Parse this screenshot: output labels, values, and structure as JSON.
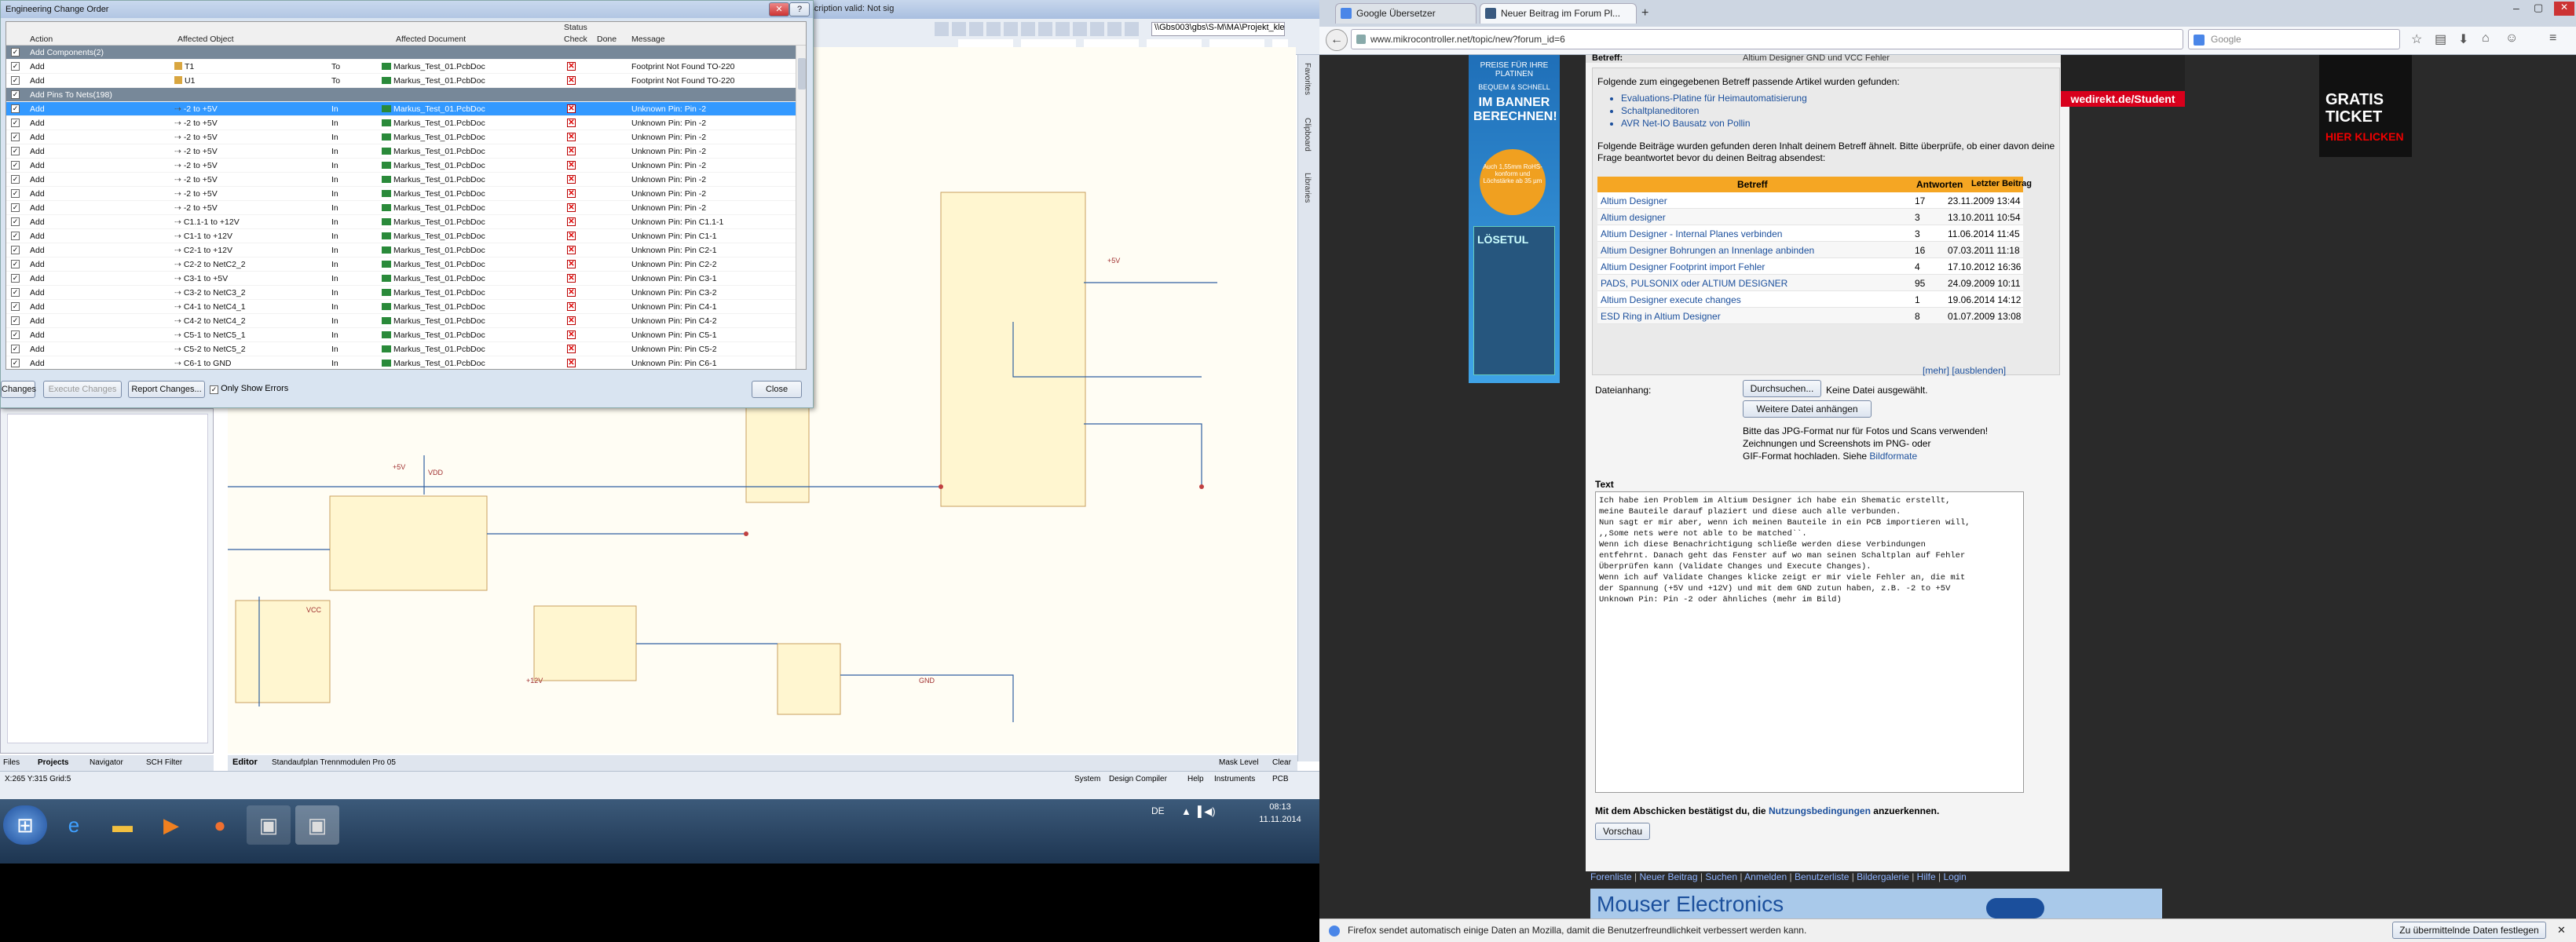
{
  "left_app": {
    "title": "...\\PCB1.PcbDoc - Altium Designer (14.3.12) Licensed to Forschungszentrum Jülich GmbH - Subscription valid: Not sig",
    "path_box": "\\\\Gbs003\\gbs\\S-M\\MA\\Projekt_kle",
    "eco": {
      "title": "Engineering Change Order",
      "col_action": "Action",
      "col_object": "Affected Object",
      "col_document": "Affected Document",
      "col_status": "Status",
      "col_check": "Check",
      "col_done": "Done",
      "col_message": "Message",
      "groups": [
        {
          "label": "Add Components(2)"
        },
        {
          "label": "Add Pins To Nets(198)"
        }
      ],
      "comp_rows": [
        {
          "action": "Add",
          "object": "T1",
          "to": "To",
          "document": "Markus_Test_01.PcbDoc",
          "message": "Footprint Not Found TO-220"
        },
        {
          "action": "Add",
          "object": "U1",
          "to": "To",
          "document": "Markus_Test_01.PcbDoc",
          "message": "Footprint Not Found TO-220"
        }
      ],
      "pin_rows": [
        {
          "action": "Add",
          "object": "-2 to +5V",
          "to": "In",
          "document": "Markus_Test_01.PcbDoc",
          "message": "Unknown Pin: Pin -2"
        },
        {
          "action": "Add",
          "object": "-2 to +5V",
          "to": "In",
          "document": "Markus_Test_01.PcbDoc",
          "message": "Unknown Pin: Pin -2"
        },
        {
          "action": "Add",
          "object": "-2 to +5V",
          "to": "In",
          "document": "Markus_Test_01.PcbDoc",
          "message": "Unknown Pin: Pin -2"
        },
        {
          "action": "Add",
          "object": "-2 to +5V",
          "to": "In",
          "document": "Markus_Test_01.PcbDoc",
          "message": "Unknown Pin: Pin -2"
        },
        {
          "action": "Add",
          "object": "-2 to +5V",
          "to": "In",
          "document": "Markus_Test_01.PcbDoc",
          "message": "Unknown Pin: Pin -2"
        },
        {
          "action": "Add",
          "object": "-2 to +5V",
          "to": "In",
          "document": "Markus_Test_01.PcbDoc",
          "message": "Unknown Pin: Pin -2"
        },
        {
          "action": "Add",
          "object": "-2 to +5V",
          "to": "In",
          "document": "Markus_Test_01.PcbDoc",
          "message": "Unknown Pin: Pin -2"
        },
        {
          "action": "Add",
          "object": "-2 to +5V",
          "to": "In",
          "document": "Markus_Test_01.PcbDoc",
          "message": "Unknown Pin: Pin -2"
        },
        {
          "action": "Add",
          "object": "C1.1-1 to +12V",
          "to": "In",
          "document": "Markus_Test_01.PcbDoc",
          "message": "Unknown Pin: Pin C1.1-1"
        },
        {
          "action": "Add",
          "object": "C1-1 to +12V",
          "to": "In",
          "document": "Markus_Test_01.PcbDoc",
          "message": "Unknown Pin: Pin C1-1"
        },
        {
          "action": "Add",
          "object": "C2-1 to +12V",
          "to": "In",
          "document": "Markus_Test_01.PcbDoc",
          "message": "Unknown Pin: Pin C2-1"
        },
        {
          "action": "Add",
          "object": "C2-2 to NetC2_2",
          "to": "In",
          "document": "Markus_Test_01.PcbDoc",
          "message": "Unknown Pin: Pin C2-2"
        },
        {
          "action": "Add",
          "object": "C3-1 to +5V",
          "to": "In",
          "document": "Markus_Test_01.PcbDoc",
          "message": "Unknown Pin: Pin C3-1"
        },
        {
          "action": "Add",
          "object": "C3-2 to NetC3_2",
          "to": "In",
          "document": "Markus_Test_01.PcbDoc",
          "message": "Unknown Pin: Pin C3-2"
        },
        {
          "action": "Add",
          "object": "C4-1 to NetC4_1",
          "to": "In",
          "document": "Markus_Test_01.PcbDoc",
          "message": "Unknown Pin: Pin C4-1"
        },
        {
          "action": "Add",
          "object": "C4-2 to NetC4_2",
          "to": "In",
          "document": "Markus_Test_01.PcbDoc",
          "message": "Unknown Pin: Pin C4-2"
        },
        {
          "action": "Add",
          "object": "C5-1 to NetC5_1",
          "to": "In",
          "document": "Markus_Test_01.PcbDoc",
          "message": "Unknown Pin: Pin C5-1"
        },
        {
          "action": "Add",
          "object": "C5-2 to NetC5_2",
          "to": "In",
          "document": "Markus_Test_01.PcbDoc",
          "message": "Unknown Pin: Pin C5-2"
        },
        {
          "action": "Add",
          "object": "C6-1 to GND",
          "to": "In",
          "document": "Markus_Test_01.PcbDoc",
          "message": "Unknown Pin: Pin C6-1"
        }
      ],
      "btn_validate": "Changes",
      "btn_execute": "Execute Changes",
      "btn_report": "Report Changes...",
      "chk_only_errors": "Only Show Errors",
      "btn_close": "Close"
    },
    "right_panels": [
      "Favorites",
      "Clipboard",
      "Libraries"
    ],
    "bottom_tabs": [
      "Files",
      "Projects",
      "Navigator",
      "SCH Filter"
    ],
    "doc_tabs": [
      "Editor",
      "Standaufplan Trennmodulen Pro 05"
    ],
    "status_coords": "X:265 Y:315   Grid:5",
    "status_right": [
      "System",
      "Design Compiler",
      "Help",
      "Instruments",
      "PCB"
    ],
    "mask_level": "Mask Level",
    "clear": "Clear",
    "schematic_labels": [
      "VDD",
      "+5V",
      "+12V",
      "GND",
      "VCC"
    ],
    "clock_time": "08:13",
    "clock_date": "11.11.2014",
    "lang": "DE"
  },
  "browser": {
    "tabs": [
      "Google Übersetzer",
      "Neuer Beitrag im Forum Pl..."
    ],
    "url": "www.mikrocontroller.net/topic/new?forum_id=6",
    "search_placeholder": "Google",
    "ad_left": {
      "line1": "PREISE FÜR IHRE PLATINEN",
      "line2": "BEQUEM & SCHNELL",
      "line3": "IM BANNER BERECHNEN!",
      "badge": "Auch 1,55mm RoHS-konform und Löchstärke ab 35 µm",
      "brand": "LÖSETUL"
    },
    "ad_top": "wedirekt.de/Student",
    "ad_right": {
      "line1": "GRATIS",
      "line2": "TICKET",
      "line3": "HIER KLICKEN"
    },
    "betreff_label": "Betreff:",
    "betreff_value": "Altium Designer GND und VCC Fehler",
    "suggest_title": "Folgende zum eingegebenen Betreff passende Artikel wurden gefunden:",
    "suggest_links": [
      "Evaluations-Platine für Heimautomatisierung",
      "Schaltplaneditoren",
      "AVR Net-IO Bausatz von Pollin"
    ],
    "similar_text": "Folgende Beiträge wurden gefunden deren Inhalt deinem Betreff ähnelt. Bitte überprüfe, ob einer davon deine Frage beantwortet bevor du deinen Beitrag absendest:",
    "table_headers": [
      "Betreff",
      "Antworten",
      "Letzter Beitrag"
    ],
    "threads": [
      {
        "title": "Altium Designer",
        "replies": "17",
        "date": "23.11.2009 13:44"
      },
      {
        "title": "Altium designer",
        "replies": "3",
        "date": "13.10.2011 10:54"
      },
      {
        "title": "Altium Designer - Internal Planes verbinden",
        "replies": "3",
        "date": "11.06.2014 11:45"
      },
      {
        "title": "Altium Designer Bohrungen an Innenlage anbinden",
        "replies": "16",
        "date": "07.03.2011 11:18"
      },
      {
        "title": "Altium Designer Footprint import Fehler",
        "replies": "4",
        "date": "17.10.2012 16:36"
      },
      {
        "title": "PADS, PULSONIX oder ALTIUM DESIGNER",
        "replies": "95",
        "date": "24.09.2009 10:11"
      },
      {
        "title": "Altium Designer execute changes",
        "replies": "1",
        "date": "19.06.2014 14:12"
      },
      {
        "title": "ESD Ring in Altium Designer",
        "replies": "8",
        "date": "01.07.2009 13:08"
      }
    ],
    "more": "[mehr]",
    "hide": "[ausblenden]",
    "attach_label": "Dateianhang:",
    "browse_btn": "Durchsuchen...",
    "no_file": "Keine Datei ausgewählt.",
    "add_file_btn": "Weitere Datei anhängen",
    "attach_hint_1": "Bitte das JPG-Format nur für Fotos und Scans verwenden!",
    "attach_hint_2": "Zeichnungen und Screenshots im PNG- oder",
    "attach_hint_3": "GIF-Format hochladen. Siehe",
    "attach_hint_link": "Bildformate",
    "text_label": "Text",
    "text_body": "Ich habe ien Problem im Altium Designer ich habe ein Shematic erstellt,\nmeine Bauteile darauf plaziert und diese auch alle verbunden.\nNun sagt er mir aber, wenn ich meinen Bauteile in ein PCB importieren will,\n,,Some nets were not able to be matched``.\nWenn ich diese Benachrichtigung schließe werden diese Verbindungen\nentfehrnt. Danach geht das Fenster auf wo man seinen Schaltplan auf Fehler\nÜberprüfen kann (Validate Changes und Execute Changes).\nWenn ich auf Validate Changes klicke zeigt er mir viele Fehler an, die mit\nder Spannung (+5V und +12V) und mit dem GND zutun haben, z.B. -2 to +5V\nUnknown Pin: Pin -2 oder ähnliches (mehr im Bild)",
    "terms_prefix": "Mit dem Abschicken bestätigst du, die",
    "terms_link": "Nutzungsbedingungen",
    "terms_suffix": "anzuerkennen.",
    "preview_btn": "Vorschau",
    "footer_links": [
      "Forenliste",
      "Neuer Beitrag",
      "Suchen",
      "Anmelden",
      "Benutzerliste",
      "Bildergalerie",
      "Hilfe",
      "Login"
    ],
    "mouser": "Mouser Electronics",
    "notification": "Firefox sendet automatisch einige Daten an Mozilla, damit die Benutzerfreundlichkeit verbessert werden kann.",
    "notification_btn": "Zu übermittelnde Daten festlegen"
  }
}
